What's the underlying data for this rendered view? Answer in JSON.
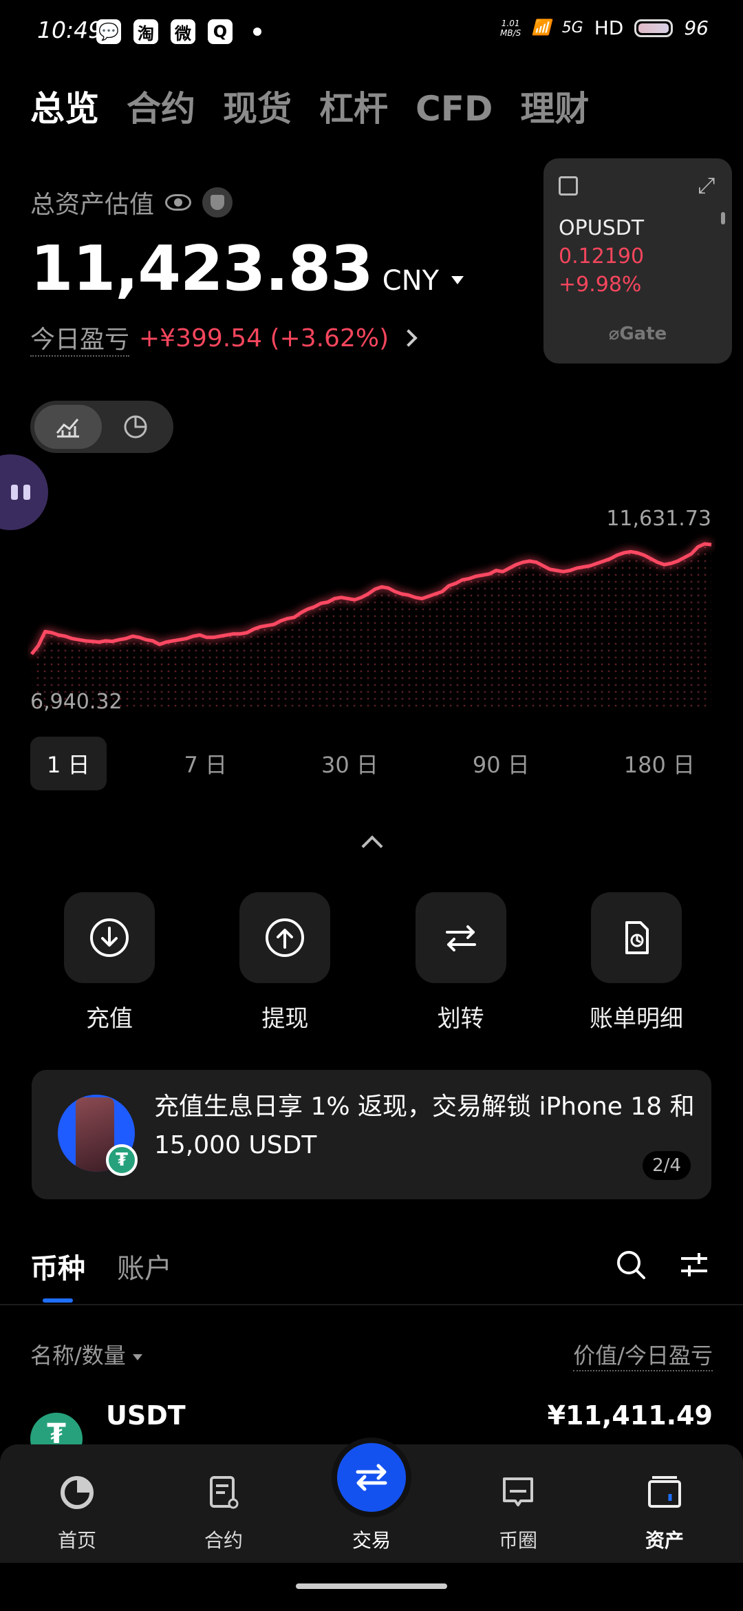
{
  "status_bar": {
    "time": "10:49",
    "net_speed_value": "1.01",
    "net_speed_unit": "MB/S",
    "signal": "5G",
    "hd": "HD",
    "battery": "96"
  },
  "top_tabs": [
    "总览",
    "合约",
    "现货",
    "杠杆",
    "CFD",
    "理财"
  ],
  "overview": {
    "label": "总资产估值",
    "total": "11,423.83",
    "currency": "CNY",
    "pnl_label": "今日盈亏",
    "pnl_value": "+¥399.54 (+3.62%)"
  },
  "widget": {
    "pair": "OPUSDT",
    "price": "0.12190",
    "change": "+9.98%",
    "brand": "Gate"
  },
  "chart_data": {
    "type": "line",
    "max_label": "11,631.73",
    "min_label": "6,940.32",
    "ylim": [
      6940.32,
      11631.73
    ],
    "values": [
      6940,
      7300,
      7900,
      7850,
      7750,
      7700,
      7600,
      7550,
      7500,
      7480,
      7450,
      7500,
      7480,
      7550,
      7600,
      7700,
      7650,
      7550,
      7500,
      7350,
      7450,
      7500,
      7550,
      7600,
      7700,
      7750,
      7650,
      7650,
      7700,
      7750,
      7800,
      7800,
      7850,
      8000,
      8100,
      8150,
      8200,
      8350,
      8450,
      8500,
      8700,
      8850,
      8950,
      9100,
      9150,
      9300,
      9350,
      9300,
      9250,
      9350,
      9500,
      9700,
      9800,
      9750,
      9600,
      9500,
      9450,
      9350,
      9300,
      9400,
      9500,
      9600,
      9850,
      9950,
      10100,
      10150,
      10250,
      10300,
      10350,
      10500,
      10450,
      10600,
      10750,
      10850,
      10900,
      10850,
      10700,
      10550,
      10500,
      10450,
      10500,
      10600,
      10650,
      10700,
      10800,
      10900,
      11000,
      11150,
      11250,
      11300,
      11250,
      11150,
      11000,
      10850,
      10750,
      10800,
      10900,
      11050,
      11200,
      11500,
      11631,
      11600
    ]
  },
  "ranges": [
    "1 日",
    "7 日",
    "30 日",
    "90 日",
    "180 日"
  ],
  "actions": [
    {
      "label": "充值"
    },
    {
      "label": "提现"
    },
    {
      "label": "划转"
    },
    {
      "label": "账单明细"
    }
  ],
  "banner": {
    "text": "充值生息日享 1% 返现，交易解锁 iPhone 18 和 15,000 USDT",
    "pager": "2/4"
  },
  "holdings": {
    "tabs": [
      "币种",
      "账户"
    ],
    "col_left": "名称/数量",
    "col_right": "价值/今日盈亏",
    "rows": [
      {
        "name": "USDT",
        "value": "¥11,411.49"
      }
    ]
  },
  "bottom_nav": [
    "首页",
    "合约",
    "交易",
    "币圈",
    "资产"
  ],
  "colors": {
    "accent_red": "#f6465d",
    "accent_blue": "#1452f0",
    "usdt_green": "#26a17b"
  }
}
